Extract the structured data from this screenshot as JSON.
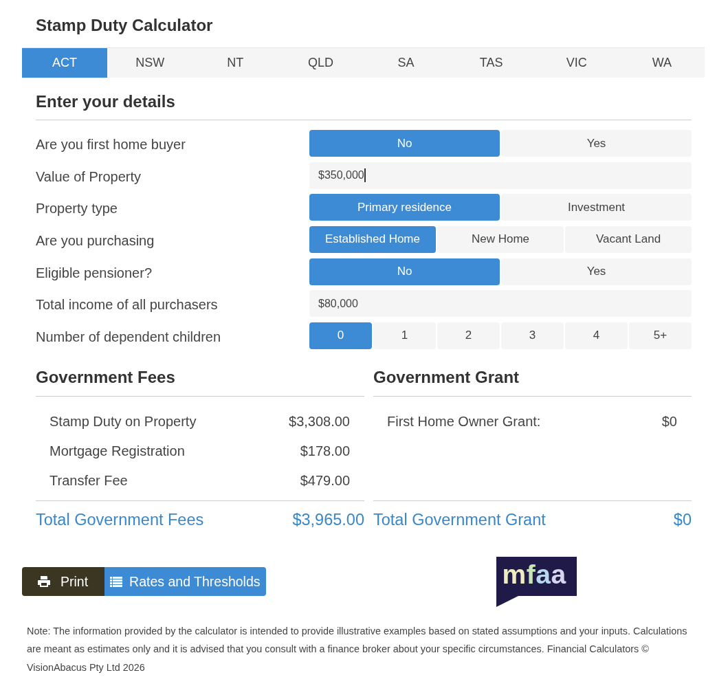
{
  "title": "Stamp Duty Calculator",
  "tabs": [
    {
      "label": "ACT",
      "selected": true
    },
    {
      "label": "NSW",
      "selected": false
    },
    {
      "label": "NT",
      "selected": false
    },
    {
      "label": "QLD",
      "selected": false
    },
    {
      "label": "SA",
      "selected": false
    },
    {
      "label": "TAS",
      "selected": false
    },
    {
      "label": "VIC",
      "selected": false
    },
    {
      "label": "WA",
      "selected": false
    }
  ],
  "details": {
    "heading": "Enter your details",
    "fields": [
      {
        "kind": "choice",
        "label": "Are you first home buyer",
        "options": [
          {
            "label": "No",
            "selected": true
          },
          {
            "label": "Yes",
            "selected": false
          }
        ]
      },
      {
        "kind": "input",
        "label": "Value of Property",
        "value": "$350,000",
        "focused": true
      },
      {
        "kind": "choice",
        "label": "Property type",
        "options": [
          {
            "label": "Primary residence",
            "selected": true
          },
          {
            "label": "Investment",
            "selected": false
          }
        ]
      },
      {
        "kind": "choice",
        "label": "Are you purchasing",
        "options": [
          {
            "label": "Established Home",
            "selected": true
          },
          {
            "label": "New Home",
            "selected": false
          },
          {
            "label": "Vacant Land",
            "selected": false
          }
        ]
      },
      {
        "kind": "choice",
        "label": "Eligible pensioner?",
        "options": [
          {
            "label": "No",
            "selected": true
          },
          {
            "label": "Yes",
            "selected": false
          }
        ]
      },
      {
        "kind": "input",
        "label": "Total income of all purchasers",
        "value": "$80,000",
        "focused": false
      },
      {
        "kind": "choice",
        "label": "Number of dependent children",
        "options": [
          {
            "label": "0",
            "selected": true
          },
          {
            "label": "1",
            "selected": false
          },
          {
            "label": "2",
            "selected": false
          },
          {
            "label": "3",
            "selected": false
          },
          {
            "label": "4",
            "selected": false
          },
          {
            "label": "5+",
            "selected": false
          }
        ]
      }
    ]
  },
  "fees": {
    "heading": "Government Fees",
    "items": [
      {
        "label": "Stamp Duty on Property",
        "amount": "$3,308.00"
      },
      {
        "label": "Mortgage Registration",
        "amount": "$178.00"
      },
      {
        "label": "Transfer Fee",
        "amount": "$479.00"
      }
    ],
    "total": {
      "label": "Total Government Fees",
      "amount": "$3,965.00"
    }
  },
  "grant": {
    "heading": "Government Grant",
    "items": [
      {
        "label": "First Home Owner Grant:",
        "amount": "$0"
      }
    ],
    "total": {
      "label": "Total Government Grant",
      "amount": "$0"
    }
  },
  "actions": [
    {
      "kind": "print",
      "label": "Print"
    },
    {
      "kind": "rates",
      "label": "Rates and Thresholds"
    }
  ],
  "logo": {
    "text": "mfaa"
  },
  "note": "Note: The information provided by the calculator is intended to provide illustrative examples based on stated assumptions and your inputs. Calculations are meant as estimates only and it is advised that you consult with a finance broker about your specific circumstances. Financial Calculators © VisionAbacus Pty Ltd 2026"
}
